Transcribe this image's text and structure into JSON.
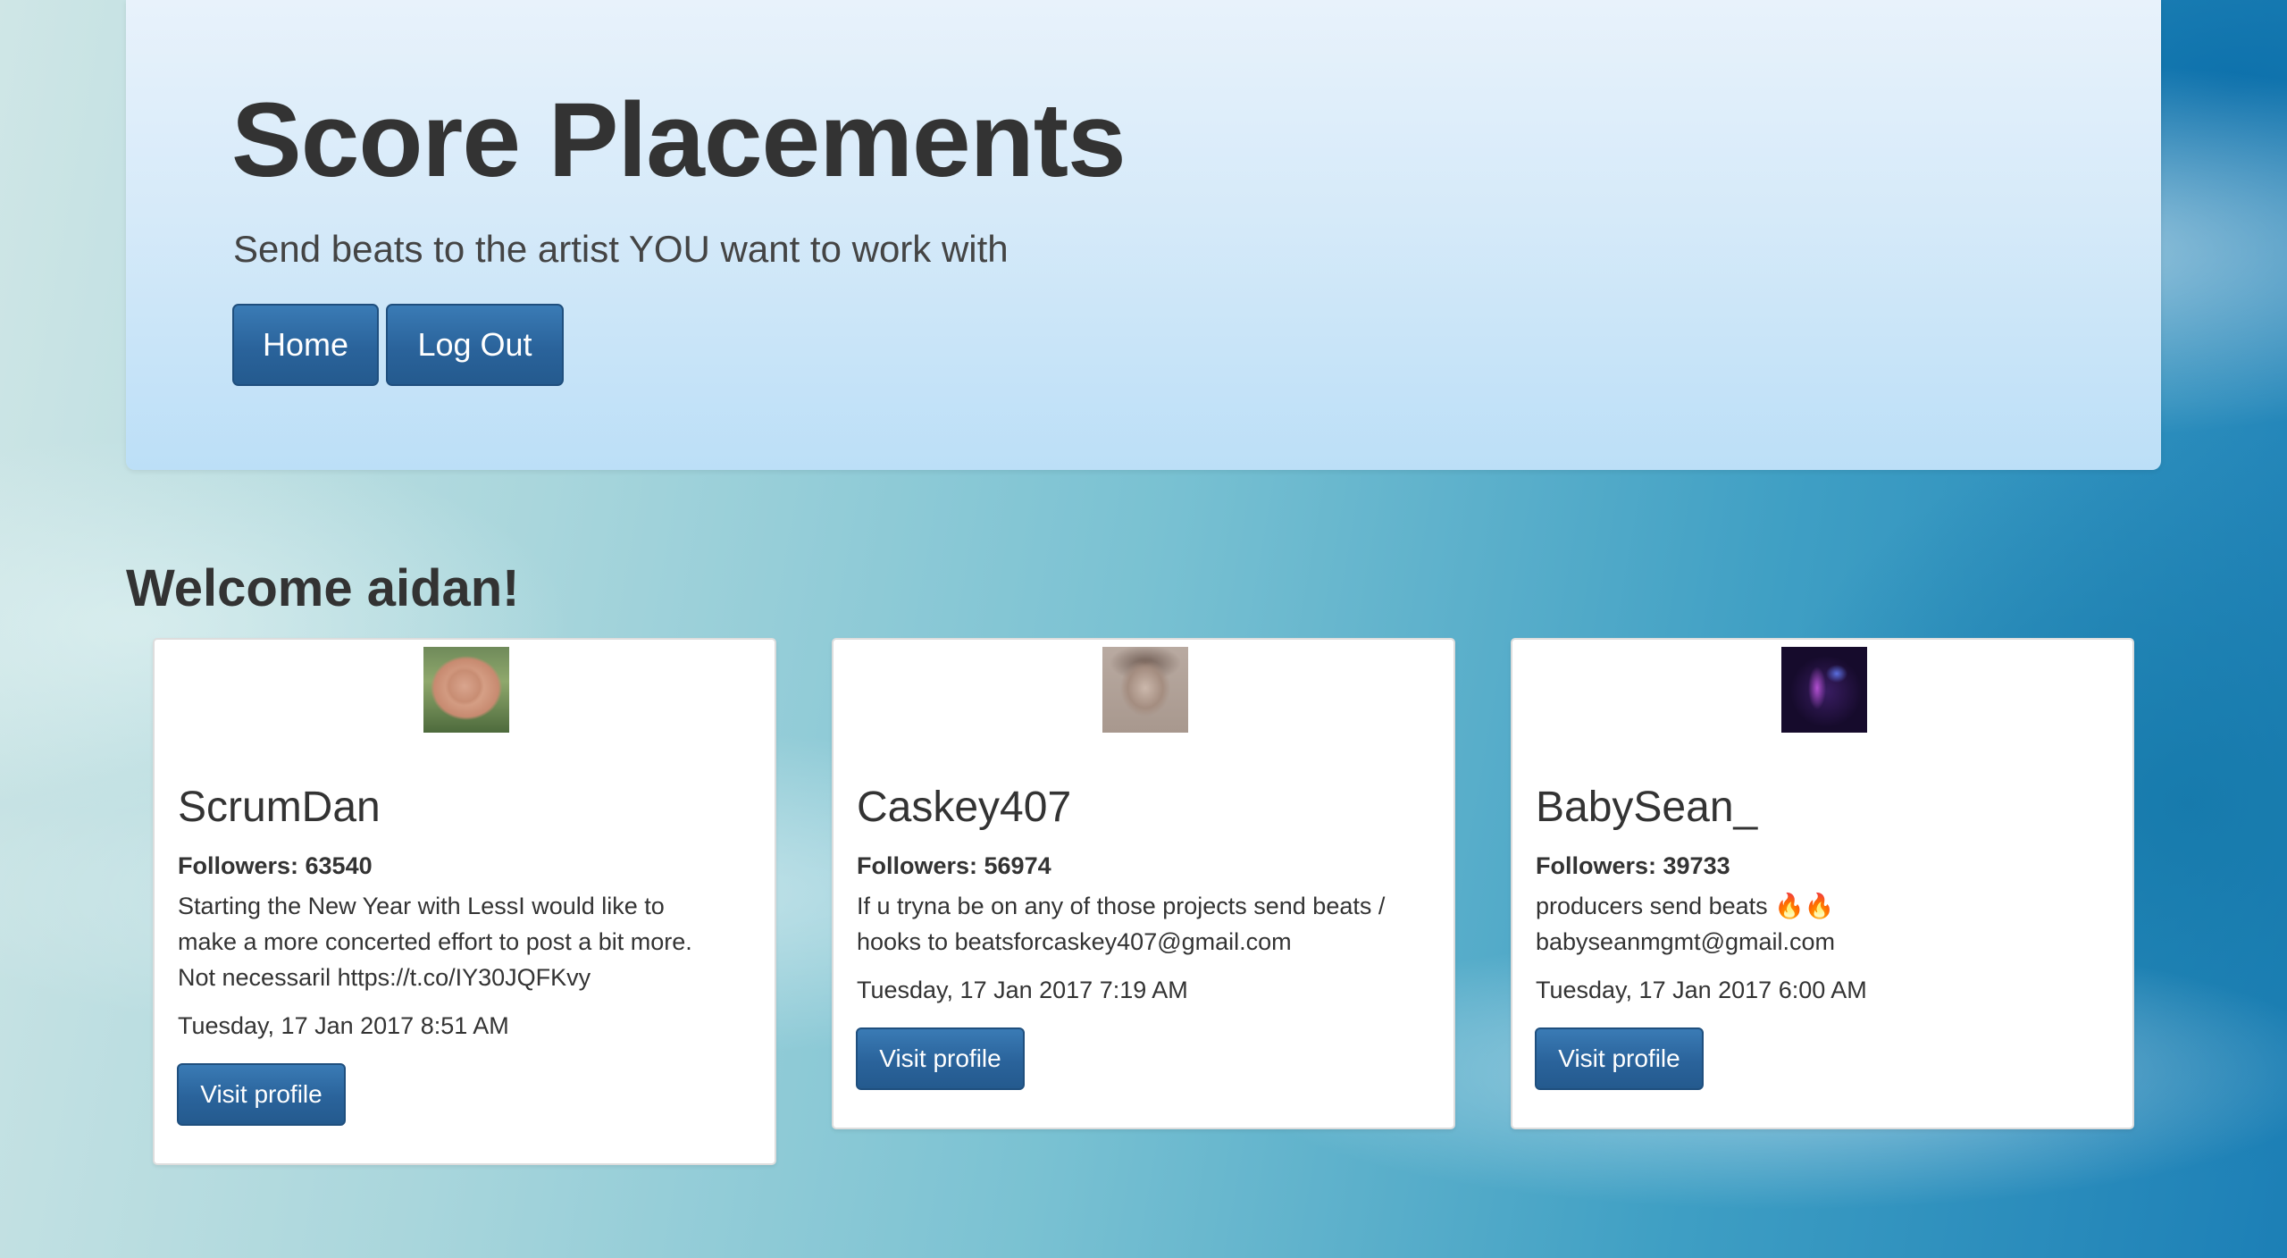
{
  "hero": {
    "title": "Score Placements",
    "subtitle": "Send beats to the artist YOU want to work with",
    "buttons": {
      "home": "Home",
      "logout": "Log Out"
    }
  },
  "welcome": "Welcome aidan!",
  "cards": [
    {
      "name": "ScrumDan",
      "followers": "Followers: 63540",
      "bio_lines": [
        "Starting the New Year with LessI would like to",
        "make a more concerted effort to post a bit more.",
        "Not necessaril https://t.co/IY30JQFKvy"
      ],
      "date": "Tuesday, 17 Jan 2017 8:51 AM",
      "button": "Visit profile"
    },
    {
      "name": "Caskey407",
      "followers": "Followers: 56974",
      "bio_lines": [
        "If u tryna be on any of those projects send beats /",
        "hooks to beatsforcaskey407@gmail.com"
      ],
      "date": "Tuesday, 17 Jan 2017 7:19 AM",
      "button": "Visit profile"
    },
    {
      "name": "BabySean_",
      "followers": "Followers: 39733",
      "bio_lines": [
        "producers send beats 🔥🔥",
        "babyseanmgmt@gmail.com"
      ],
      "date": "Tuesday, 17 Jan 2017 6:00 AM",
      "button": "Visit profile"
    }
  ],
  "colors": {
    "button_blue": "#2a639b",
    "hero_bg": "#d6eaf9",
    "text": "#333333"
  }
}
